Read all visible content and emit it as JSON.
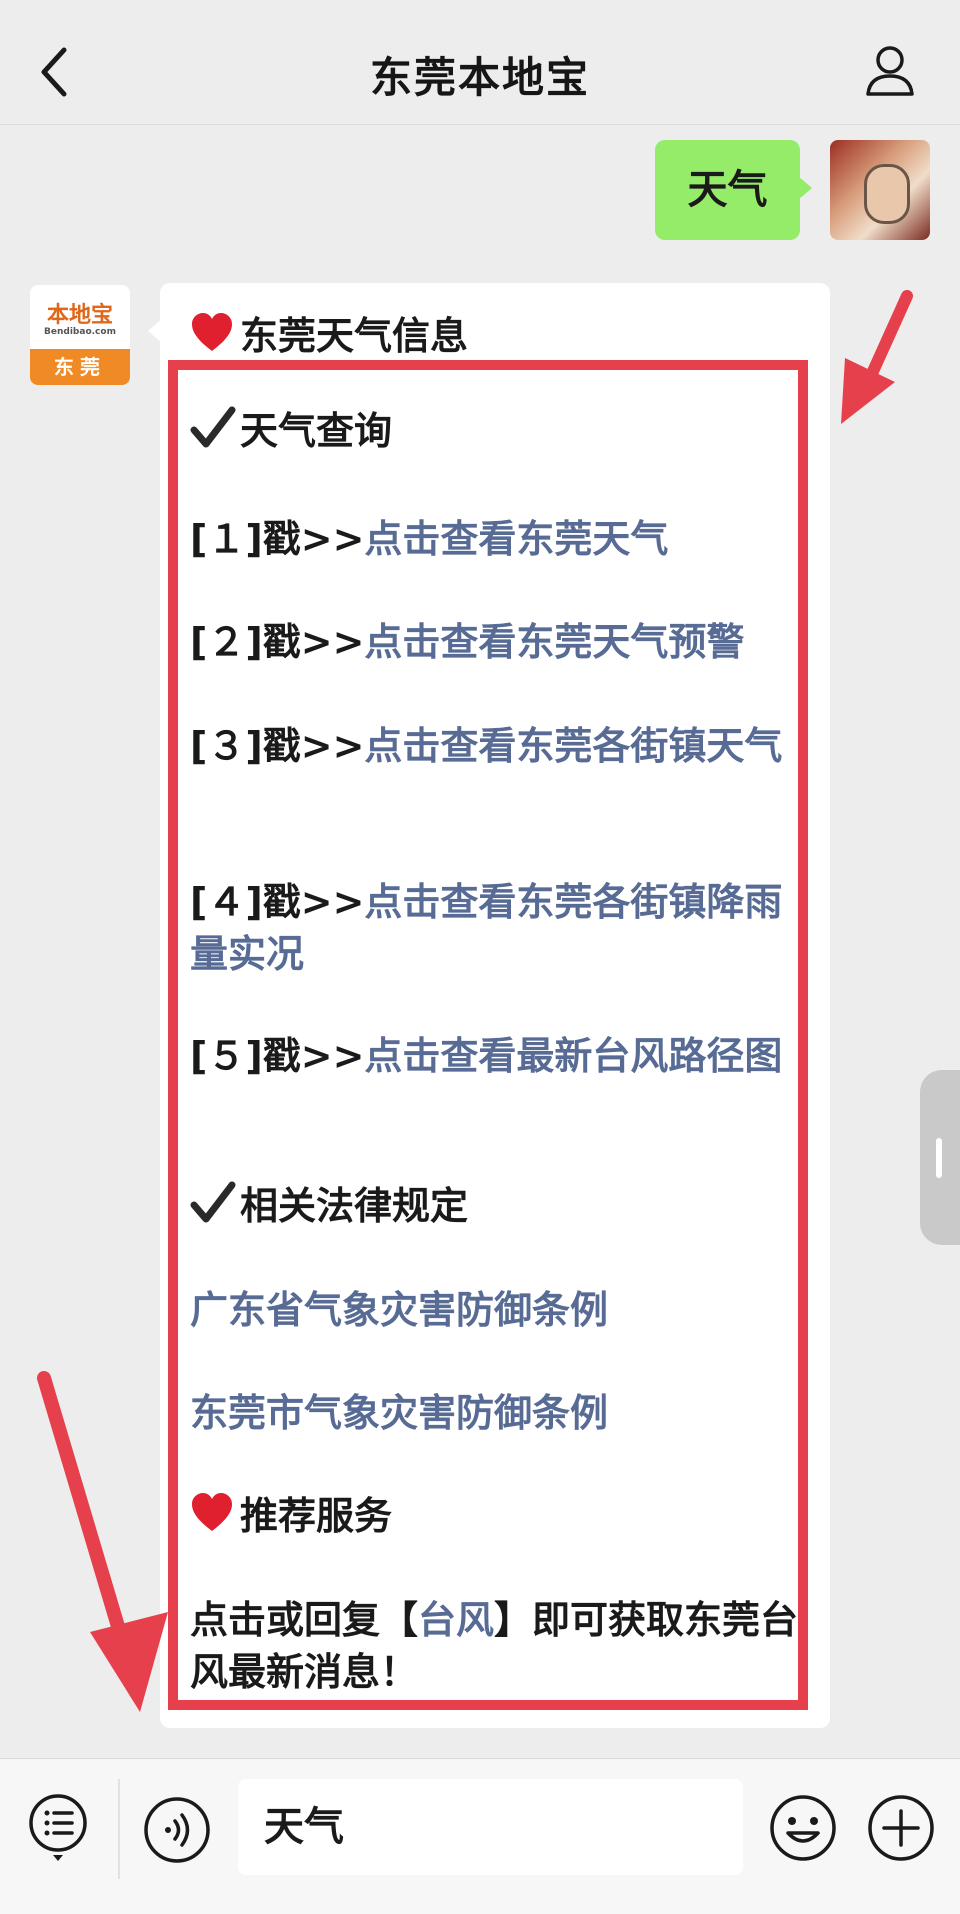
{
  "header": {
    "title": "东莞本地宝"
  },
  "outgoing_message": {
    "text": "天气"
  },
  "bot_avatar": {
    "logo_top": "本地宝",
    "logo_sub": "Bendibao.com",
    "logo_bottom": "东莞"
  },
  "incoming_message": {
    "header": "东莞天气信息",
    "section1_title": "天气查询",
    "items": [
      {
        "prefix": "[１]戳>>",
        "link": "点击查看东莞天气"
      },
      {
        "prefix": "[２]戳>>",
        "link": "点击查看东莞天气预警"
      },
      {
        "prefix": "[３]戳>>",
        "link": "点击查看东莞各街镇天气"
      },
      {
        "prefix": "[４]戳>>",
        "link": "点击查看东莞各街镇降雨量实况"
      },
      {
        "prefix": "[５]戳>>",
        "link": "点击查看最新台风路径图"
      }
    ],
    "section2_title": "相关法律规定",
    "law_links": [
      "广东省气象灾害防御条例",
      "东莞市气象灾害防御条例"
    ],
    "section3_title": "推荐服务",
    "recommend": {
      "before": "点击或回复【",
      "link": "台风",
      "after": "】即可获取东莞台风最新消息！"
    }
  },
  "input_bar": {
    "value": "天气"
  },
  "colors": {
    "accent_link": "#576b95",
    "frame_red": "#e5404b",
    "bubble_green": "#95ec69"
  },
  "icons": [
    "back-icon",
    "profile-icon",
    "heart-icon",
    "check-icon",
    "menu-icon",
    "voice-icon",
    "emoji-icon",
    "plus-icon"
  ]
}
